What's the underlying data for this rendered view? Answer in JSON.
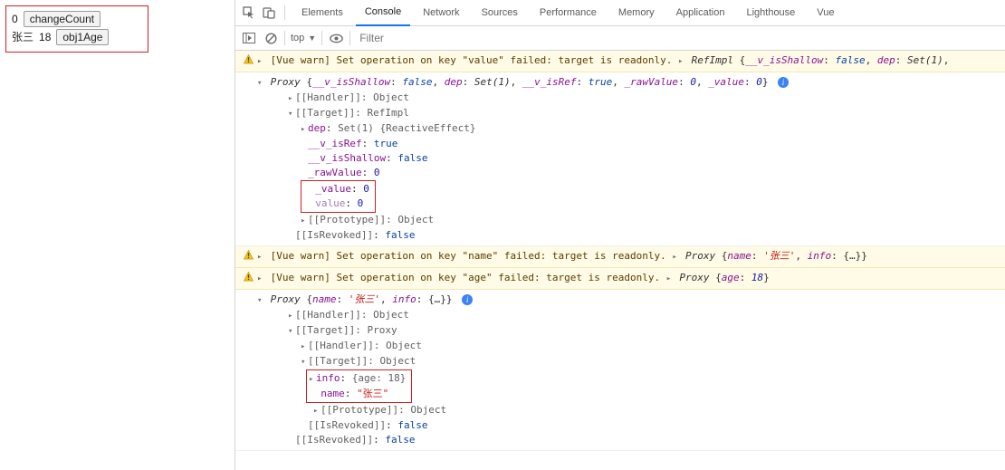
{
  "page": {
    "count_value": "0",
    "btn_change_count": "changeCount",
    "name_value": "张三",
    "age_value": "18",
    "btn_obj1_age": "obj1Age"
  },
  "devtools": {
    "tabs": [
      "Elements",
      "Console",
      "Network",
      "Sources",
      "Performance",
      "Memory",
      "Application",
      "Lighthouse",
      "Vue"
    ],
    "active_tab": "Console",
    "toolbar": {
      "context": "top",
      "filter_placeholder": "Filter"
    }
  },
  "console": {
    "warn1": {
      "text": "[Vue warn] Set operation on key \"value\" failed: target is readonly.",
      "obj_head": "RefImpl",
      "obj_preview": "{__v_isShallow: false, dep: Set(1),"
    },
    "proxy1": {
      "head": "Proxy",
      "preview_parts": {
        "k1": "__v_isShallow",
        "v1": "false",
        "k2": "dep",
        "v2": "Set(1)",
        "k3": "__v_isRef",
        "v3": "true",
        "k4": "_rawValue",
        "v4": "0",
        "k5": "_value",
        "v5": "0"
      },
      "tree": {
        "handler": "[[Handler]]: Object",
        "target": "[[Target]]: RefImpl",
        "dep": "dep: Set(1) {ReactiveEffect}",
        "is_ref_k": "__v_isRef",
        "is_ref_v": "true",
        "is_shallow_k": "__v_isShallow",
        "is_shallow_v": "false",
        "raw_k": "_rawValue",
        "raw_v": "0",
        "uvalue_k": "_value",
        "uvalue_v": "0",
        "value_k": "value",
        "value_v": "0",
        "proto": "[[Prototype]]: Object",
        "revoked_k": "[[IsRevoked]]",
        "revoked_v": "false"
      }
    },
    "warn2": {
      "text": "[Vue warn] Set operation on key \"name\" failed: target is readonly.",
      "obj_head": "Proxy",
      "obj_preview": "{name: '张三', info: {…}}"
    },
    "warn3": {
      "text": "[Vue warn] Set operation on key \"age\" failed: target is readonly.",
      "obj_head": "Proxy",
      "obj_preview": "{age: 18}"
    },
    "proxy2": {
      "head": "Proxy",
      "preview": "{name: '张三', info: {…}}",
      "tree": {
        "handler": "[[Handler]]: Object",
        "target": "[[Target]]: Proxy",
        "handler2": "[[Handler]]: Object",
        "target2": "[[Target]]: Object",
        "info_k": "info",
        "info_v": "{age: 18}",
        "name_k": "name",
        "name_v": "\"张三\"",
        "proto": "[[Prototype]]: Object",
        "revoked_k": "[[IsRevoked]]",
        "revoked_v": "false",
        "revoked2_k": "[[IsRevoked]]",
        "revoked2_v": "false"
      }
    }
  }
}
